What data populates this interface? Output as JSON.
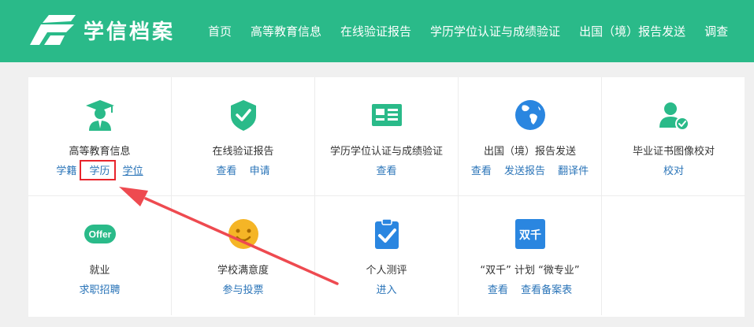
{
  "header": {
    "app_title": "学信档案",
    "brand_color": "#2aba89",
    "nav": [
      {
        "label": "首页"
      },
      {
        "label": "高等教育信息"
      },
      {
        "label": "在线验证报告"
      },
      {
        "label": "学历学位认证与成绩验证"
      },
      {
        "label": "出国（境）报告发送"
      },
      {
        "label": "调查"
      }
    ]
  },
  "services": [
    {
      "title": "高等教育信息",
      "icon": "graduate-icon",
      "links": [
        "学籍",
        "学历",
        "学位"
      ]
    },
    {
      "title": "在线验证报告",
      "icon": "shield-check-icon",
      "links": [
        "查看",
        "申请"
      ]
    },
    {
      "title": "学历学位认证与成绩验证",
      "icon": "id-card-icon",
      "links": [
        "查看"
      ]
    },
    {
      "title": "出国（境）报告发送",
      "icon": "globe-icon",
      "links": [
        "查看",
        "发送报告",
        "翻译件"
      ]
    },
    {
      "title": "毕业证书图像校对",
      "icon": "user-check-icon",
      "links": [
        "校对"
      ]
    },
    {
      "title": "就业",
      "icon": "offer-icon",
      "icon_text": "Offer",
      "links": [
        "求职招聘"
      ]
    },
    {
      "title": "学校满意度",
      "icon": "smiley-icon",
      "links": [
        "参与投票"
      ]
    },
    {
      "title": "个人测评",
      "icon": "clipboard-check-icon",
      "links": [
        "进入"
      ]
    },
    {
      "title": "“双千” 计划 “微专业”",
      "icon": "shuangqian-icon",
      "icon_text": "双千",
      "links": [
        "查看",
        "查看备案表"
      ]
    }
  ],
  "annotation": {
    "highlight_color": "#e8242c",
    "highlighted_link": "学历"
  }
}
